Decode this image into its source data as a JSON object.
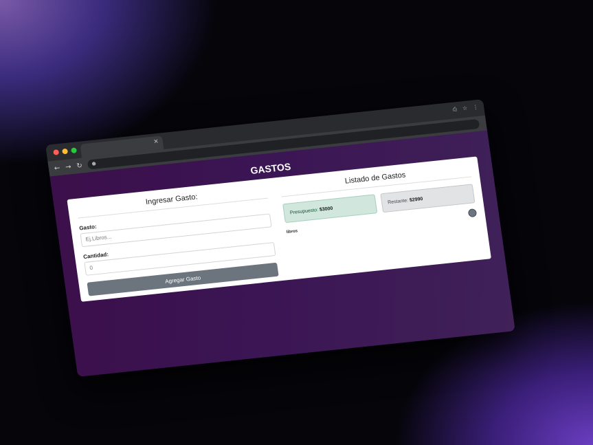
{
  "page": {
    "title": "GASTOS"
  },
  "browser": {
    "tab_close_glyph": "×"
  },
  "form": {
    "section_title": "Ingresar Gasto:",
    "gasto_label": "Gasto:",
    "gasto_placeholder": "Ej.Libros...",
    "cantidad_label": "Cantidad:",
    "cantidad_value": "0",
    "submit_label": "Agregar Gasto"
  },
  "list": {
    "section_title": "Listado de Gastos",
    "presupuesto_label": "Presupuesto:",
    "presupuesto_value": "$3000",
    "restante_label": "Restante:",
    "restante_value": "$2990",
    "items": [
      {
        "name": "libros"
      }
    ]
  },
  "colors": {
    "accent": "#6c757d",
    "background": "#3b1554",
    "presupuesto_bg": "#d1e7dd",
    "restante_bg": "#e2e3e5"
  }
}
